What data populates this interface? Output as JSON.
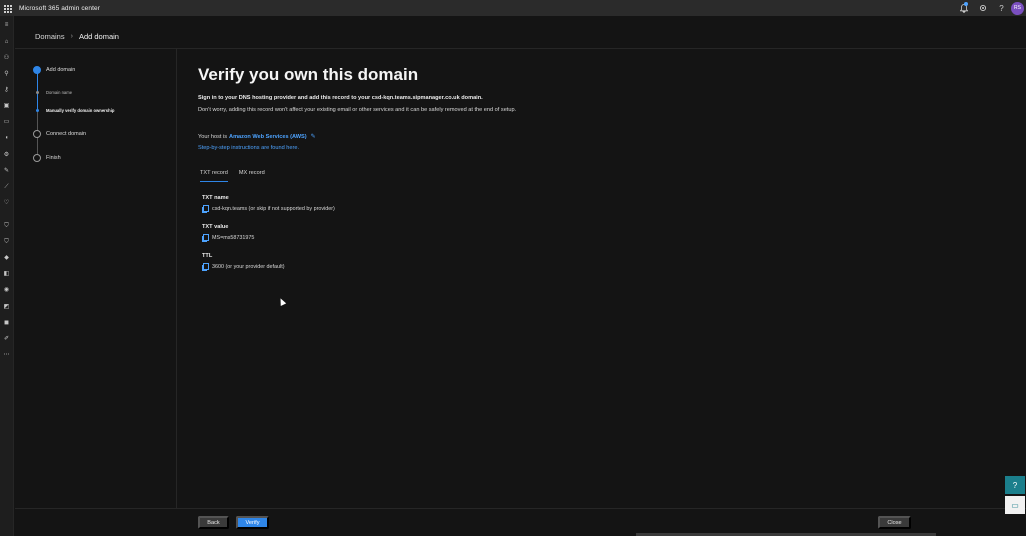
{
  "app": {
    "title": "Microsoft 365 admin center",
    "avatar_initials": "RS"
  },
  "topbar_icons": [
    "notification-bell-icon",
    "gear-icon",
    "help-icon"
  ],
  "rail_icons": [
    "hamburger-icon",
    "home-icon",
    "user-icon",
    "group-icon",
    "roles-icon",
    "resources-icon",
    "billing-icon",
    "support-icon",
    "settings-icon",
    "setup-icon",
    "reports-icon",
    "health-icon",
    "security-icon",
    "compliance-icon",
    "endpoint-icon",
    "exchange-icon",
    "sharepoint-icon",
    "teams-icon",
    "azure-icon",
    "edit-nav-icon",
    "more-icon"
  ],
  "breadcrumb": {
    "parent": "Domains",
    "current": "Add domain"
  },
  "stepper": {
    "steps": [
      {
        "label": "Add domain"
      },
      {
        "label": "Domain name"
      },
      {
        "label": "Manually verify domain ownership"
      },
      {
        "label": "Connect domain"
      },
      {
        "label": "Finish"
      }
    ]
  },
  "main": {
    "title": "Verify you own this domain",
    "instruction_bold": "Sign in to your DNS hosting provider and add this record to your csd-kqn.teams.sipmanager.co.uk domain.",
    "instruction": "Don't worry, adding this record won't affect your existing email or other services and it can be safely removed at the end of setup.",
    "host_prefix": "Your host is",
    "host_name": "Amazon Web Services (AWS)",
    "instructions_link": "Step-by-step instructions are found here.",
    "tabs": [
      {
        "label": "TXT record"
      },
      {
        "label": "MX record"
      }
    ],
    "fields": {
      "txt_name": {
        "label": "TXT name",
        "value": "csd-kqn.teams (or skip if not supported by provider)"
      },
      "txt_value": {
        "label": "TXT value",
        "value": "MS=ms58731975"
      },
      "ttl": {
        "label": "TTL",
        "value": "3600 (or your provider default)"
      }
    }
  },
  "footer": {
    "back": "Back",
    "verify": "Verify",
    "close": "Close"
  },
  "colors": {
    "accent": "#2f86e8",
    "link": "#4da3ff",
    "background": "#141414",
    "topbar": "#2b2b2b"
  }
}
